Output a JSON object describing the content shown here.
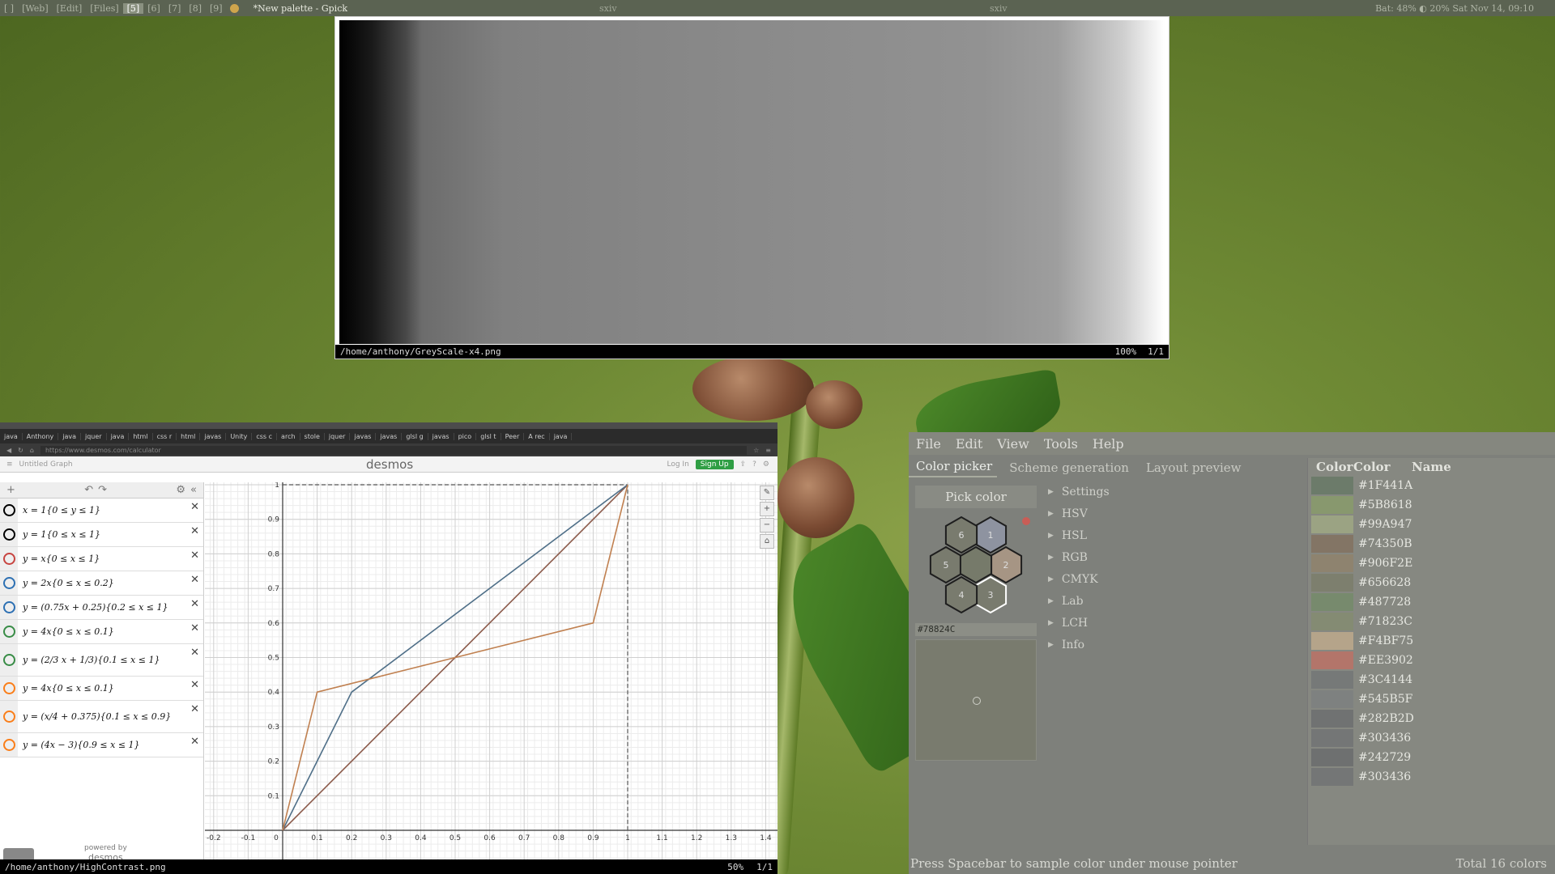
{
  "topbar": {
    "workspaces": [
      "[ ]",
      "[Web]",
      "[Edit]",
      "[Files]",
      "[5]",
      "[6]",
      "[7]",
      "[8]",
      "[9]"
    ],
    "active_index": 4,
    "window_title": "*New palette - Gpick",
    "center_title_1": "sxiv",
    "center_title_2": "sxiv",
    "status": "Bat: 48%  ◐ 20%  Sat Nov 14, 09:10"
  },
  "sxiv_top": {
    "path": "/home/anthony/GreyScale-x4.png",
    "zoom": "100%",
    "page": "1/1"
  },
  "browser": {
    "tabs": [
      "java",
      "Anthony",
      "java",
      "jquer",
      "java",
      "html",
      "css r",
      "html",
      "javas",
      "Unity",
      "css c",
      "arch",
      "stole",
      "jquer",
      "javas",
      "javas",
      "glsl g",
      "javas",
      "pico",
      "glsl t",
      "Peer",
      "A rec",
      "java"
    ],
    "url": "https://www.desmos.com/calculator",
    "graph_title": "Untitled Graph",
    "logo": "desmos",
    "login": "Log In",
    "signup": "Sign Up",
    "powered_by": "powered by",
    "powered_logo": "desmos"
  },
  "expressions": [
    {
      "text": "x = 1{0 ≤ y ≤ 1}",
      "color": "#000000"
    },
    {
      "text": "y = 1{0 ≤ x ≤ 1}",
      "color": "#000000"
    },
    {
      "text": "y = x{0 ≤ x ≤ 1}",
      "color": "#c74440"
    },
    {
      "text": "y = 2x{0 ≤ x ≤ 0.2}",
      "color": "#2d70b3"
    },
    {
      "text": "y = (0.75x + 0.25){0.2 ≤ x ≤ 1}",
      "color": "#2d70b3"
    },
    {
      "text": "y = 4x{0 ≤ x ≤ 0.1}",
      "color": "#388c46"
    },
    {
      "text": "y = (2/3 x + 1/3){0.1 ≤ x ≤ 1}",
      "color": "#388c46"
    },
    {
      "text": "y = 4x{0 ≤ x ≤ 0.1}",
      "color": "#fa7e19"
    },
    {
      "text": "y = (x/4 + 0.375){0.1 ≤ x ≤ 0.9}",
      "color": "#fa7e19"
    },
    {
      "text": "y = (4x − 3){0.9 ≤ x ≤ 1}",
      "color": "#fa7e19"
    }
  ],
  "chart_data": {
    "type": "line",
    "xlim": [
      -0.2,
      1.4
    ],
    "ylim": [
      -0.05,
      1.02
    ],
    "x_ticks": [
      "-0.2",
      "-0.1",
      "0",
      "0.1",
      "0.2",
      "0.3",
      "0.4",
      "0.5",
      "0.6",
      "0.7",
      "0.8",
      "0.9",
      "1",
      "1.1",
      "1.2",
      "1.3",
      "1.4"
    ],
    "y_ticks": [
      "0.1",
      "0.2",
      "0.3",
      "0.4",
      "0.5",
      "0.6",
      "0.7",
      "0.8",
      "0.9",
      "1"
    ],
    "series": [
      {
        "color": "#8b5a4a",
        "points": [
          [
            0,
            0
          ],
          [
            1,
            1
          ]
        ]
      },
      {
        "color": "#4f6f88",
        "points": [
          [
            0,
            0
          ],
          [
            0.2,
            0.4
          ],
          [
            1,
            1
          ]
        ]
      },
      {
        "color": "#c08050",
        "points": [
          [
            0,
            0
          ],
          [
            0.1,
            0.4
          ],
          [
            0.9,
            0.6
          ],
          [
            1,
            1
          ]
        ]
      }
    ],
    "guides": [
      {
        "style": "dashed",
        "points": [
          [
            0,
            1
          ],
          [
            1,
            1
          ]
        ]
      },
      {
        "style": "dashed",
        "points": [
          [
            1,
            0
          ],
          [
            1,
            1
          ]
        ]
      }
    ]
  },
  "sxiv_bottom": {
    "path": "/home/anthony/HighContrast.png",
    "zoom": "50%",
    "page": "1/1"
  },
  "gpick": {
    "menu": [
      "File",
      "Edit",
      "View",
      "Tools",
      "Help"
    ],
    "tabs": [
      "Color picker",
      "Scheme generation",
      "Layout preview"
    ],
    "pick_button": "Pick color",
    "hex_cells": [
      {
        "n": "1",
        "color": "#8e93a0"
      },
      {
        "n": "2",
        "color": "#a69584"
      },
      {
        "n": "3",
        "color": "#797b6e"
      },
      {
        "n": "4",
        "color": "#797b6e"
      },
      {
        "n": "5",
        "color": "#797b6e"
      },
      {
        "n": "6",
        "color": "#797b6e"
      },
      {
        "n": "",
        "color": "#767a6a"
      }
    ],
    "current_hex": "#78824C",
    "sections": [
      "Settings",
      "HSV",
      "HSL",
      "RGB",
      "CMYK",
      "Lab",
      "LCH",
      "Info"
    ],
    "palette_headers": [
      "Color",
      "Color",
      "Name"
    ],
    "palette": [
      {
        "hex": "#1F441A",
        "swatch": "#6c7b6a"
      },
      {
        "hex": "#5B8618",
        "swatch": "#88986e"
      },
      {
        "hex": "#99A947",
        "swatch": "#9ba383"
      },
      {
        "hex": "#74350B",
        "swatch": "#837565"
      },
      {
        "hex": "#906F2E",
        "swatch": "#8e836f"
      },
      {
        "hex": "#656628",
        "swatch": "#7d7f6e"
      },
      {
        "hex": "#487728",
        "swatch": "#778a6d"
      },
      {
        "hex": "#71823C",
        "swatch": "#848b73"
      },
      {
        "hex": "#F4BF75",
        "swatch": "#b5a48a"
      },
      {
        "hex": "#EE3902",
        "swatch": "#b3756a"
      },
      {
        "hex": "#3C4144",
        "swatch": "#767978"
      },
      {
        "hex": "#545B5F",
        "swatch": "#7e8180"
      },
      {
        "hex": "#282B2D",
        "swatch": "#707272"
      },
      {
        "hex": "#303436",
        "swatch": "#747676"
      },
      {
        "hex": "#242729",
        "swatch": "#6e7070"
      },
      {
        "hex": "#303436",
        "swatch": "#747676"
      }
    ],
    "status": "Press Spacebar to sample color under mouse pointer",
    "total": "Total 16 colors"
  }
}
